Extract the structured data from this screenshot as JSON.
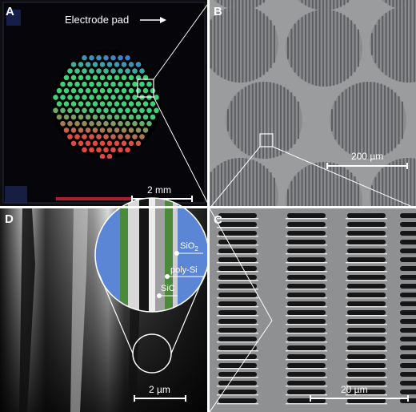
{
  "panels": [
    {
      "letter": "A",
      "annotation": "Electrode pad",
      "scale_bar": "2 mm"
    },
    {
      "letter": "B",
      "scale_bar": "200 µm"
    },
    {
      "letter": "C",
      "scale_bar": "20 µm"
    },
    {
      "letter": "D",
      "scale_bar": "2 µm",
      "layers": {
        "sio_main": "SiO",
        "sio_sub": "2",
        "polysi": "poly-Si",
        "sic": "SiC"
      }
    }
  ],
  "colors": {
    "background": "#ffffff",
    "sem_gray": "#9a9c9e",
    "dot_blue": "#3f6fd8",
    "dot_green": "#3fd07a",
    "dot_red": "#e04840",
    "inset_blue": "#5b86d6"
  }
}
